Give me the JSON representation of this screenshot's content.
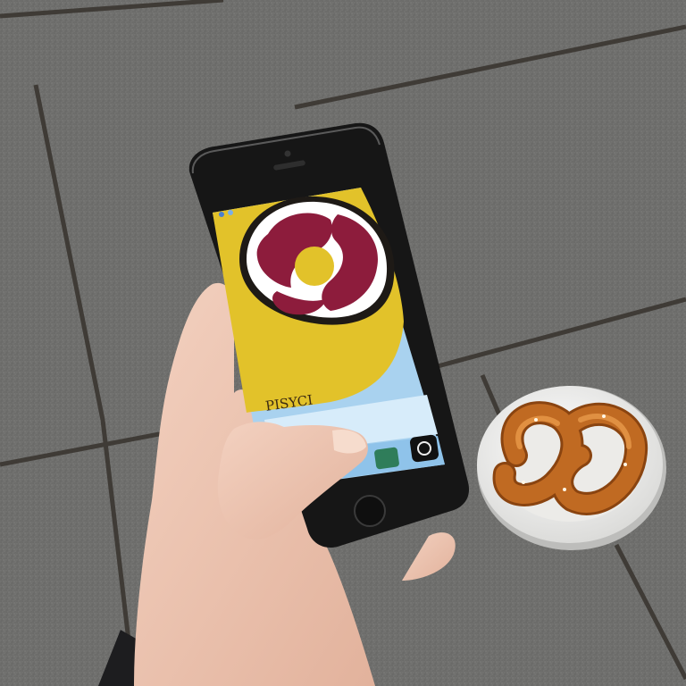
{
  "screen": {
    "app_label": "PISYCI",
    "icon_name": "pretzel-icon"
  },
  "colors": {
    "pavement": "#6f6f6d",
    "phone_body": "#151515",
    "screen_yellow": "#e2c22a",
    "screen_blue": "#a9d2ef",
    "pretzel_icon_red": "#8d1c3c",
    "pretzel_brown": "#b5651d",
    "plate": "#f4f4f2",
    "skin": "#f0c7b3"
  }
}
